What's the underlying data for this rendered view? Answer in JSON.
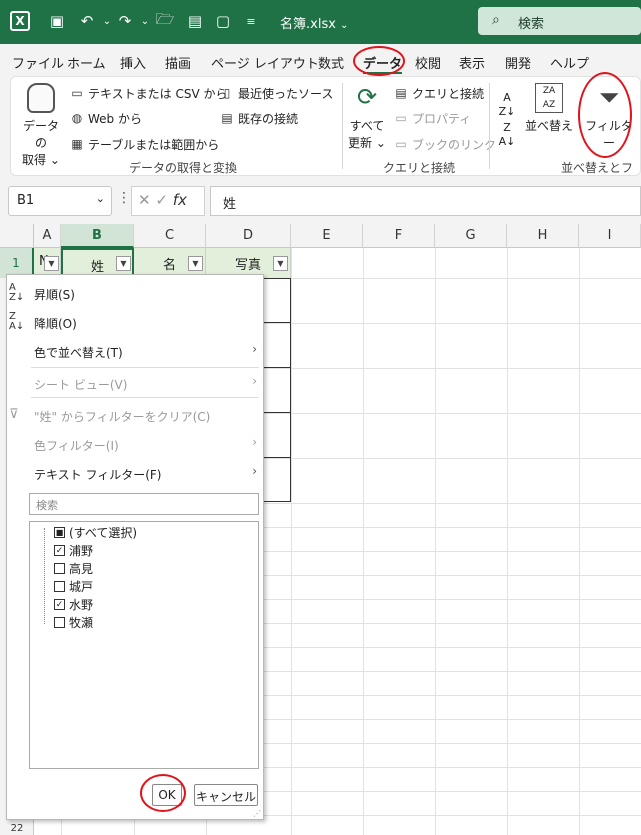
{
  "titlebar": {
    "filename": "名簿.xlsx",
    "search_placeholder": "検索"
  },
  "menu": {
    "tabs": [
      "ファイル",
      "ホーム",
      "挿入",
      "描画",
      "ページ レイアウト",
      "数式",
      "データ",
      "校閲",
      "表示",
      "開発",
      "ヘルプ"
    ]
  },
  "ribbon": {
    "get_data": {
      "line1": "データの",
      "line2": "取得"
    },
    "text_csv": "テキストまたは CSV から",
    "web": "Web から",
    "table_range": "テーブルまたは範囲から",
    "recent_sources": "最近使ったソース",
    "existing_conn": "既存の接続",
    "group_get_transform": "データの取得と変換",
    "refresh_all": {
      "line1": "すべて",
      "line2": "更新"
    },
    "queries_conn": "クエリと接続",
    "properties": "プロパティ",
    "edit_links": "ブックのリンク",
    "group_queries": "クエリと接続",
    "sort": "並べ替え",
    "filter": "フィルター",
    "group_sort_filter": "並べ替えとフィルター"
  },
  "formula_bar": {
    "name_box": "B1",
    "formula": "姓",
    "fx": "fx"
  },
  "columns": [
    "A",
    "B",
    "C",
    "D",
    "E",
    "F",
    "G",
    "H",
    "I"
  ],
  "row1": {
    "row_num": "1",
    "A": "N",
    "B": "姓",
    "C": "名",
    "D": "写真"
  },
  "row_last": "22",
  "filter_menu": {
    "sort_asc": "昇順(S)",
    "sort_desc": "降順(O)",
    "sort_color": "色で並べ替え(T)",
    "sheet_view": "シート ビュー(V)",
    "clear_filter": "\"姓\" からフィルターをクリア(C)",
    "color_filter": "色フィルター(I)",
    "text_filter": "テキスト フィルター(F)",
    "search_placeholder": "検索",
    "items": [
      {
        "label": "(すべて選択)",
        "state": "partial"
      },
      {
        "label": "浦野",
        "state": "checked"
      },
      {
        "label": "高見",
        "state": "unchecked"
      },
      {
        "label": "城戸",
        "state": "unchecked"
      },
      {
        "label": "水野",
        "state": "checked"
      },
      {
        "label": "牧瀬",
        "state": "unchecked"
      }
    ],
    "ok": "OK",
    "cancel": "キャンセル"
  }
}
